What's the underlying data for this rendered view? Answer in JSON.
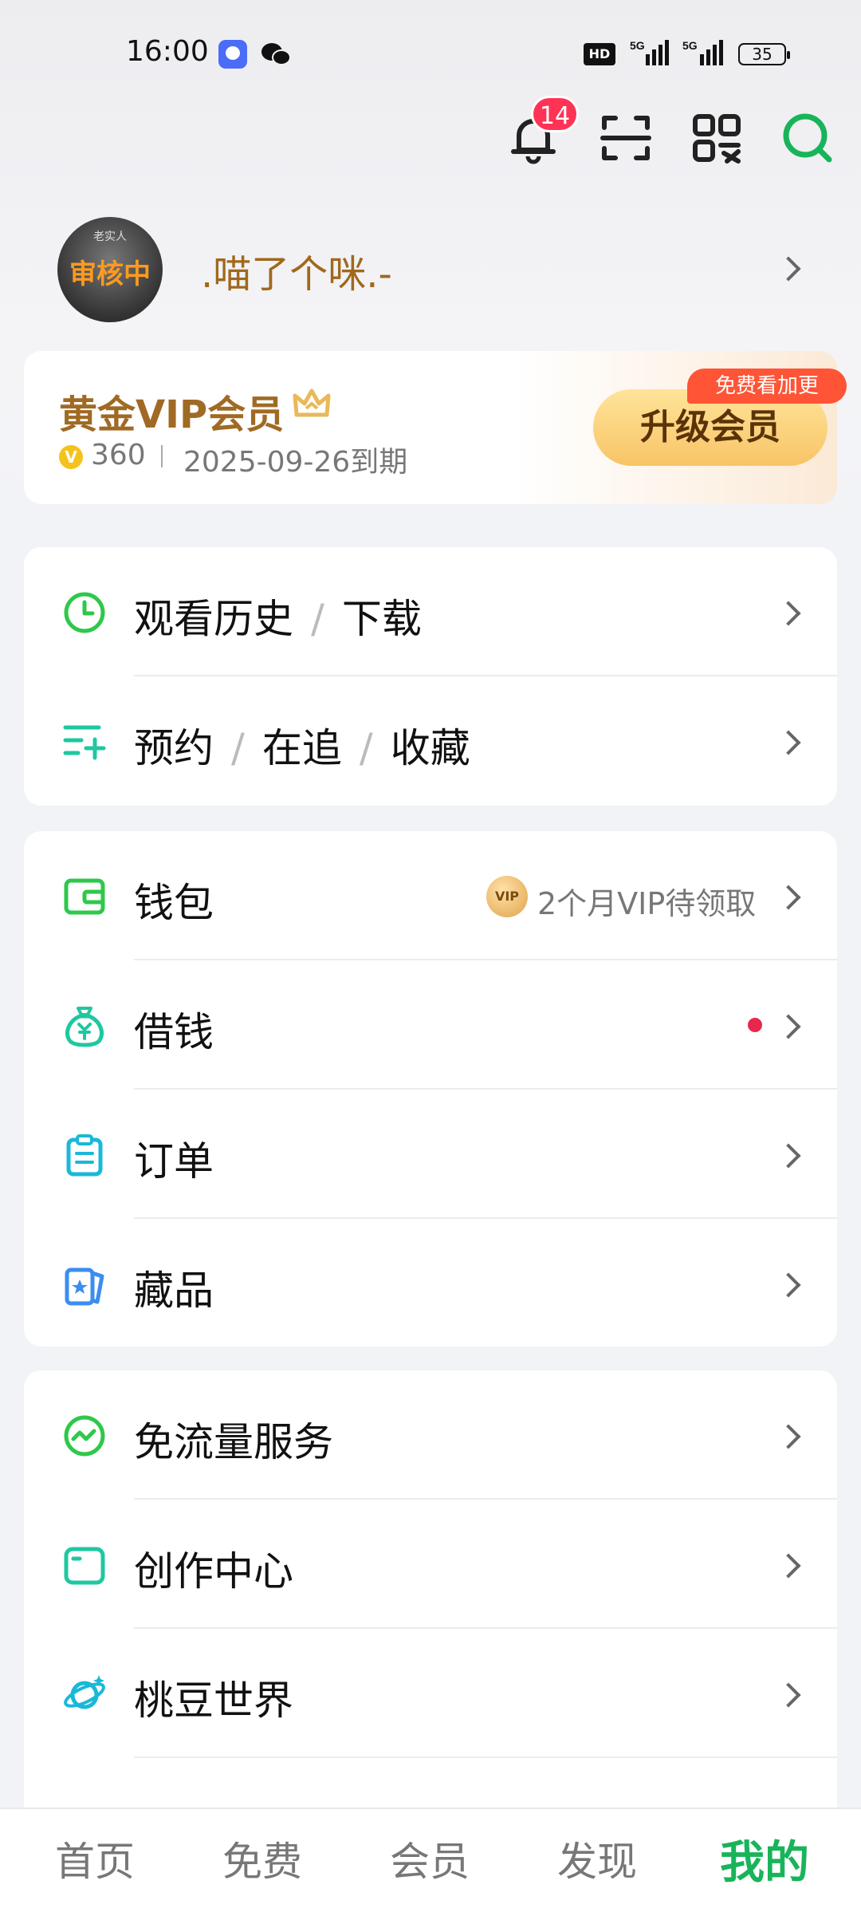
{
  "status_bar": {
    "time": "16:00",
    "network_hd": "HD",
    "network_1": "5G",
    "network_2": "5G",
    "battery": "35",
    "app_icons": [
      "chat-app-icon",
      "wechat-icon"
    ]
  },
  "header": {
    "notification_count": "14",
    "icons": [
      "bell-icon",
      "scan-icon",
      "qr-code-icon",
      "search-icon"
    ]
  },
  "profile": {
    "avatar_caption": "老实人",
    "avatar_status": "审核中",
    "username": ".喵了个咪.-"
  },
  "vip": {
    "title": "黄金VIP会员",
    "coin_symbol": "V",
    "points": "360",
    "expire": "2025-09-26到期",
    "upgrade_label": "升级会员",
    "promo_tag": "免费看加更"
  },
  "section1": {
    "history": [
      "观看历史",
      "下载"
    ],
    "follow": [
      "预约",
      "在追",
      "收藏"
    ]
  },
  "section2": {
    "wallet": "钱包",
    "wallet_vip_badge": "VIP",
    "wallet_extra": "2个月VIP待领取",
    "loan": "借钱",
    "orders": "订单",
    "collectibles": "藏品"
  },
  "section3": {
    "free_data": "免流量服务",
    "creator": "创作中心",
    "world": "桃豆世界"
  },
  "tabs": [
    "首页",
    "免费",
    "会员",
    "发现",
    "我的"
  ],
  "colors": {
    "brand_green": "#18b45a",
    "gold": "#a06a24",
    "badge_red": "#ff3355"
  }
}
